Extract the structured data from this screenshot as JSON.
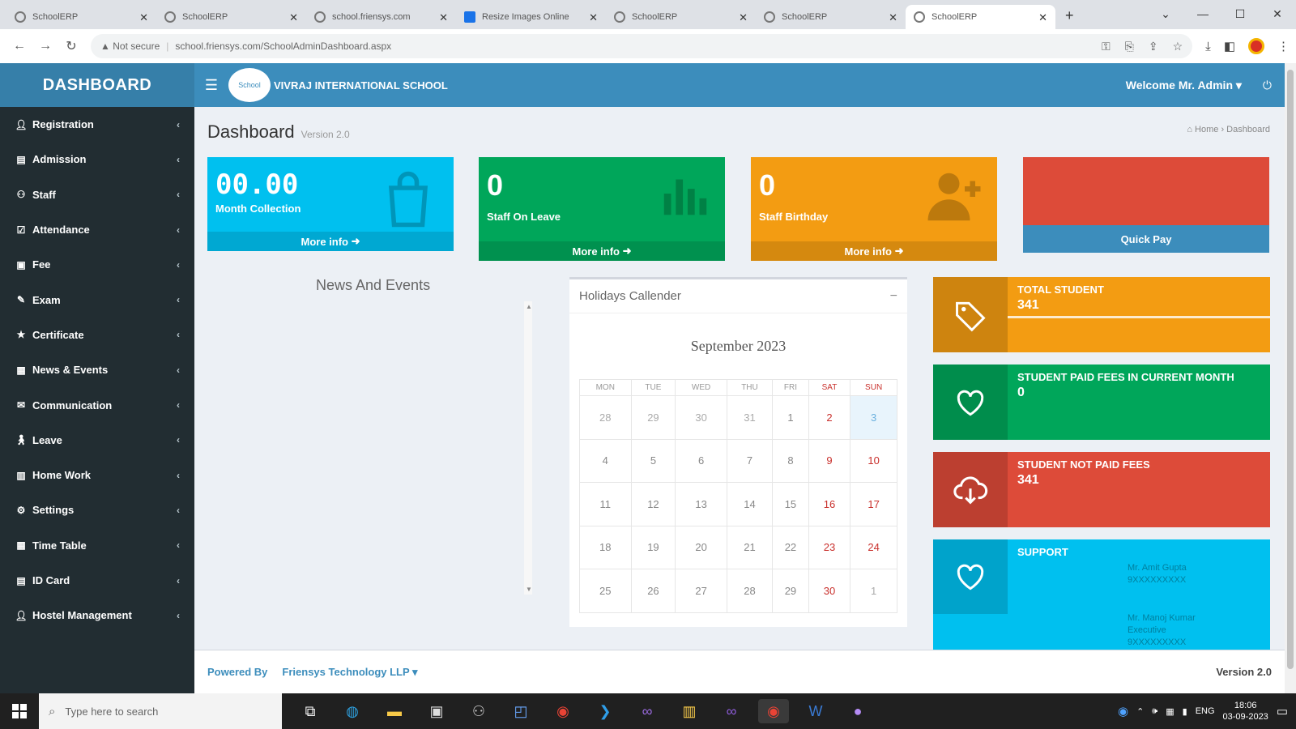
{
  "browser": {
    "tabs": [
      {
        "title": "SchoolERP",
        "icon": "globe-icon"
      },
      {
        "title": "SchoolERP",
        "icon": "globe-icon"
      },
      {
        "title": "school.friensys.com",
        "icon": "globe-icon"
      },
      {
        "title": "Resize Images Online",
        "icon": "image-icon"
      },
      {
        "title": "SchoolERP",
        "icon": "globe-icon"
      },
      {
        "title": "SchoolERP",
        "icon": "globe-icon"
      },
      {
        "title": "SchoolERP",
        "icon": "globe-icon",
        "active": true
      }
    ],
    "security_label": "Not secure",
    "url": "school.friensys.com/SchoolAdminDashboard.aspx"
  },
  "sidebar": {
    "brand": "DASHBOARD",
    "items": [
      {
        "label": "Registration",
        "icon": "user-icon"
      },
      {
        "label": "Admission",
        "icon": "id-card-icon"
      },
      {
        "label": "Staff",
        "icon": "users-icon"
      },
      {
        "label": "Attendance",
        "icon": "check-square-icon"
      },
      {
        "label": "Fee",
        "icon": "money-icon"
      },
      {
        "label": "Exam",
        "icon": "edit-icon"
      },
      {
        "label": "Certificate",
        "icon": "star-icon"
      },
      {
        "label": "News & Events",
        "icon": "newspaper-icon"
      },
      {
        "label": "Communication",
        "icon": "comments-icon"
      },
      {
        "label": "Leave",
        "icon": "walking-icon"
      },
      {
        "label": "Home Work",
        "icon": "book-icon"
      },
      {
        "label": "Settings",
        "icon": "gear-icon"
      },
      {
        "label": "Time Table",
        "icon": "table-icon"
      },
      {
        "label": "ID Card",
        "icon": "id-badge-icon"
      },
      {
        "label": "Hostel Management",
        "icon": "user-icon"
      }
    ]
  },
  "header": {
    "logo_alt": "School",
    "school_name": "VIVRAJ INTERNATIONAL SCHOOL",
    "welcome": "Welcome Mr. Admin"
  },
  "page": {
    "title": "Dashboard",
    "version": "Version 2.0",
    "breadcrumb_home": "Home",
    "breadcrumb_current": "Dashboard"
  },
  "stats": {
    "month_collection": {
      "value": "00.00",
      "label": "Month Collection",
      "link": "More info",
      "color": "#00c0ef"
    },
    "staff_on_leave": {
      "value": "0",
      "label": "Staff On Leave",
      "link": "More info",
      "color": "#00a65a"
    },
    "staff_birthday": {
      "value": "0",
      "label": "Staff Birthday",
      "link": "More info",
      "color": "#f39c12"
    },
    "quick_pay": {
      "label": "Quick Pay",
      "color": "#dd4b39"
    }
  },
  "news": {
    "title": "News And Events"
  },
  "calendar": {
    "title": "Holidays Callender",
    "month": "September 2023",
    "weekdays": [
      "MON",
      "TUE",
      "WED",
      "THU",
      "FRI",
      "SAT",
      "SUN"
    ],
    "weeks": [
      [
        "28",
        "29",
        "30",
        "31",
        "1",
        "2",
        "3"
      ],
      [
        "4",
        "5",
        "6",
        "7",
        "8",
        "9",
        "10"
      ],
      [
        "11",
        "12",
        "13",
        "14",
        "15",
        "16",
        "17"
      ],
      [
        "18",
        "19",
        "20",
        "21",
        "22",
        "23",
        "24"
      ],
      [
        "25",
        "26",
        "27",
        "28",
        "29",
        "30",
        "1"
      ]
    ]
  },
  "info_boxes": {
    "total_student": {
      "title": "TOTAL STUDENT",
      "value": "341",
      "color": "#f39c12"
    },
    "paid_fees": {
      "title": "STUDENT PAID FEES IN CURRENT MONTH",
      "value": "0",
      "color": "#00a65a"
    },
    "not_paid": {
      "title": "STUDENT NOT PAID FEES",
      "value": "341",
      "color": "#dd4b39"
    },
    "support": {
      "title": "SUPPORT",
      "color": "#00c0ef",
      "contact1": "Mr. Amit Gupta",
      "contact1_phone": "9XXXXXXXXX",
      "contact2": "Mr. Manoj Kumar",
      "contact2_role": "Executive",
      "contact2_phone": "9XXXXXXXXX"
    }
  },
  "footer": {
    "powered_by": "Powered By",
    "company": "Friensys Technology LLP",
    "version": "Version 2.0"
  },
  "taskbar": {
    "search_placeholder": "Type here to search",
    "lang": "ENG",
    "time": "18:06",
    "date": "03-09-2023"
  }
}
